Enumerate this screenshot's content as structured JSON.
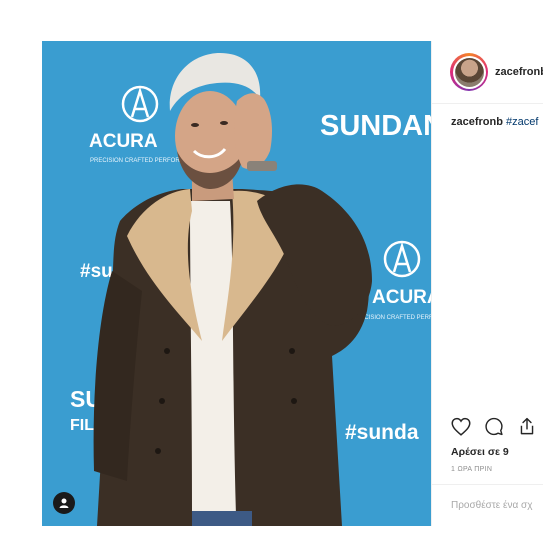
{
  "post": {
    "username": "zacefronb",
    "caption_user": "zacefronb",
    "caption_hashtag": "#zacef",
    "likes_text": "Αρέσει σε 9",
    "time_text": "1 ΩΡΑ ΠΡΙΝ",
    "comment_placeholder": "Προσθέστε ένα σχ"
  },
  "photo": {
    "backdrop": {
      "brand1": "ACURA",
      "brand1_tagline": "PRECISION CRAFTED PERFORMANCE",
      "brand2": "SUNDANCE",
      "hashtag_left": "#su",
      "hashtag_right": "#sunda",
      "sun_left_1": "SU",
      "sun_left_2": "FIL"
    }
  },
  "icons": {
    "like": "heart-icon",
    "comment": "comment-icon",
    "share": "share-icon",
    "tagged": "user-tag-icon"
  },
  "colors": {
    "backdrop_blue": "#3a9dd0",
    "hashtag_link": "#00376b",
    "muted_text": "#8e8e8e"
  }
}
